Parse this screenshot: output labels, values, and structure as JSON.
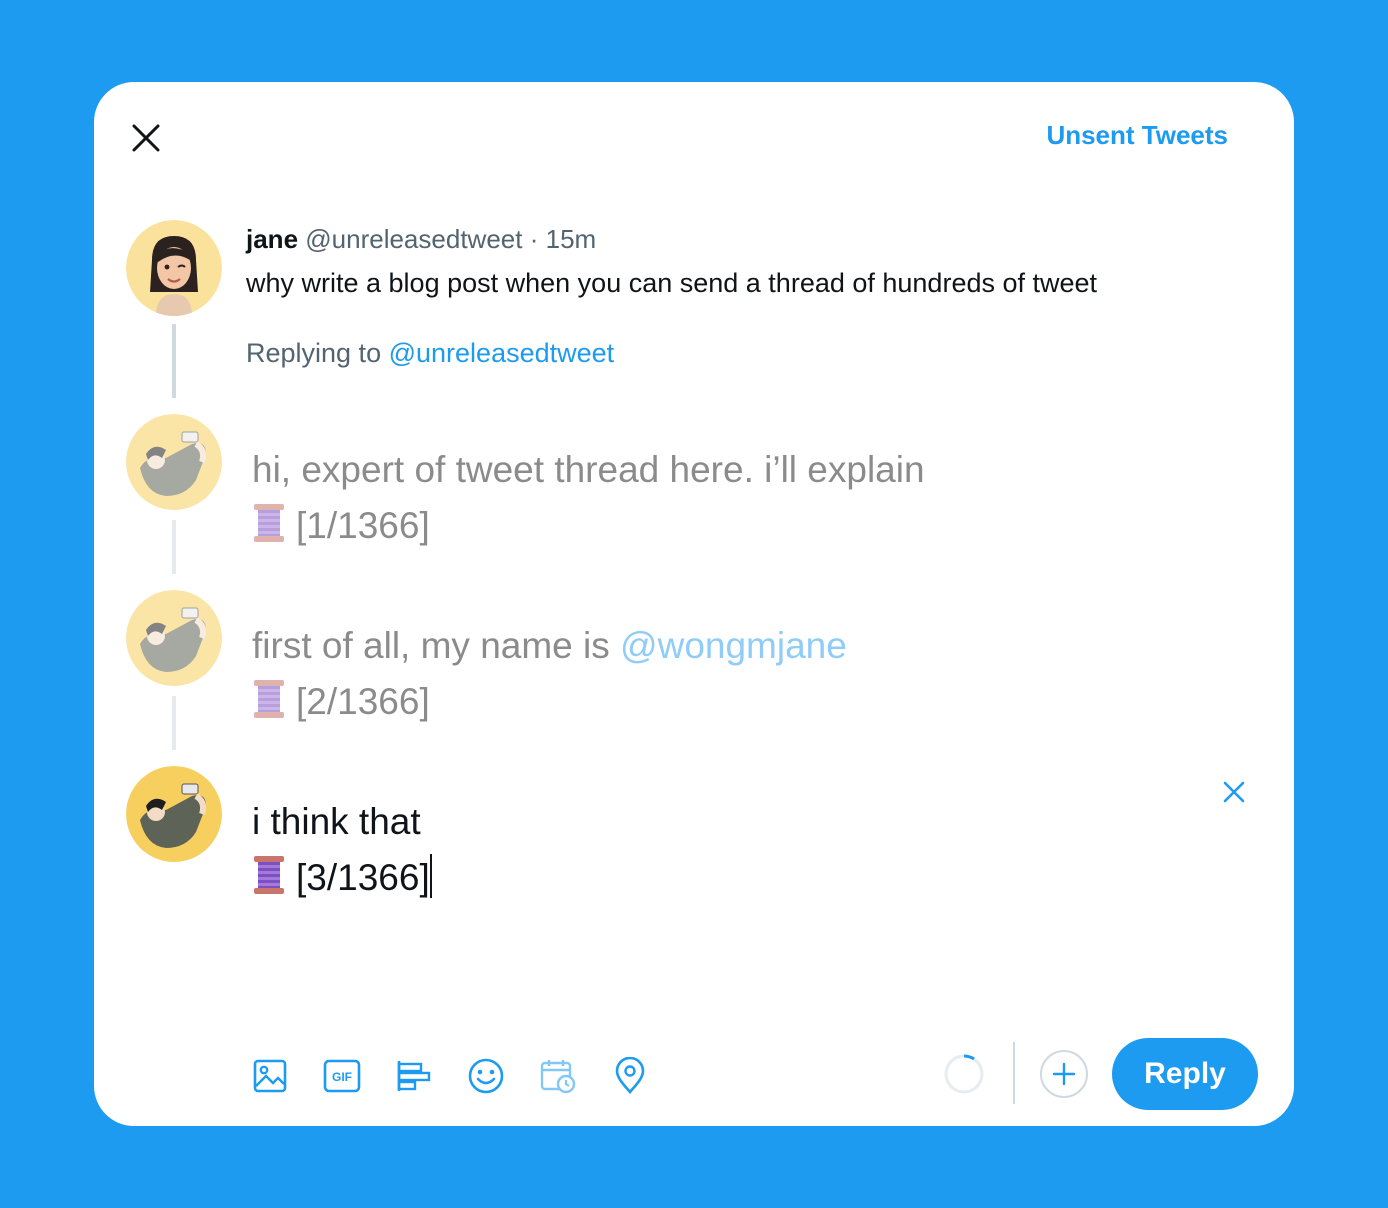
{
  "header": {
    "close_icon": "close-icon",
    "unsent_label": "Unsent Tweets"
  },
  "original_tweet": {
    "name": "jane",
    "handle": "@unreleasedtweet",
    "separator": "·",
    "time": "15m",
    "text": "why write a blog post when you can send a thread of hundreds of tweet"
  },
  "replying": {
    "prefix": "Replying to",
    "handle": "@unreleasedtweet"
  },
  "drafts": [
    {
      "line1": "hi, expert of tweet thread here. i’ll explain",
      "counter": "[1/1366]"
    },
    {
      "line1_prefix": "first of all, my name is",
      "mention": "@wongmjane",
      "counter": "[2/1366]"
    },
    {
      "line1": "i think that",
      "counter": "[3/1366]"
    }
  ],
  "toolbar": {
    "icons": [
      "image-icon",
      "gif-icon",
      "poll-icon",
      "emoji-icon",
      "schedule-icon",
      "location-icon"
    ],
    "gif_text": "GIF",
    "reply_label": "Reply"
  },
  "colors": {
    "background": "#1d9bf0",
    "accent": "#1d9bf0",
    "text": "#0f1419",
    "muted": "#536471"
  }
}
